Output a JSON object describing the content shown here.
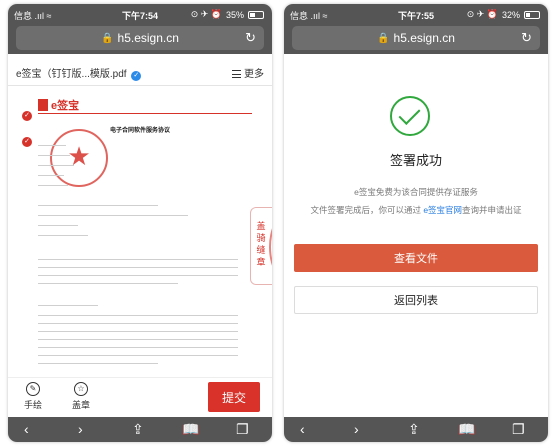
{
  "left": {
    "status": {
      "carrier": "信息 .ııl ≈",
      "time": "下午7:54",
      "battery": "35%",
      "battery_level": 0.35,
      "status_icons": "⊙ ✈ ⏰"
    },
    "browser": {
      "url": "h5.esign.cn",
      "lock_glyph": "🔒",
      "reload_glyph": "↻"
    },
    "doc": {
      "title": "e签宝（钉钉版...模版.pdf",
      "verified_glyph": "✓",
      "more_label": "更多",
      "logo_text": "e签宝",
      "doc_heading": "电子合同软件服务协议",
      "check_glyph": "✓",
      "riding_seal_text": "盖骑缝章"
    },
    "footer": {
      "draw_label": "手绘",
      "draw_icon": "✎",
      "seal_label": "盖章",
      "seal_icon": "☆",
      "submit_label": "提交"
    },
    "toolbar": {
      "back": "‹",
      "forward": "›",
      "share": "⇪",
      "bookmarks": "📖",
      "tabs": "❐"
    }
  },
  "right": {
    "status": {
      "carrier": "信息 .ııl ≈",
      "time": "下午7:55",
      "battery": "32%",
      "battery_level": 0.32,
      "status_icons": "⊙ ✈ ⏰"
    },
    "browser": {
      "url": "h5.esign.cn",
      "lock_glyph": "🔒",
      "reload_glyph": "↻"
    },
    "result": {
      "title": "签署成功",
      "msg1": "e签宝免费为该合同提供存证服务",
      "msg2_before": "文件签署完成后，你可以通过 ",
      "msg2_link": "e签宝官网",
      "msg2_after": "查询并申请出证",
      "view_button": "查看文件",
      "back_button": "返回列表"
    },
    "toolbar": {
      "back": "‹",
      "forward": "›",
      "share": "⇪",
      "bookmarks": "📖",
      "tabs": "❐"
    }
  },
  "colors": {
    "accent_red": "#d8322a",
    "button_orange": "#d95a3c",
    "success_green": "#31a83e",
    "link_blue": "#2a7ee0",
    "browser_gray": "#555555"
  }
}
